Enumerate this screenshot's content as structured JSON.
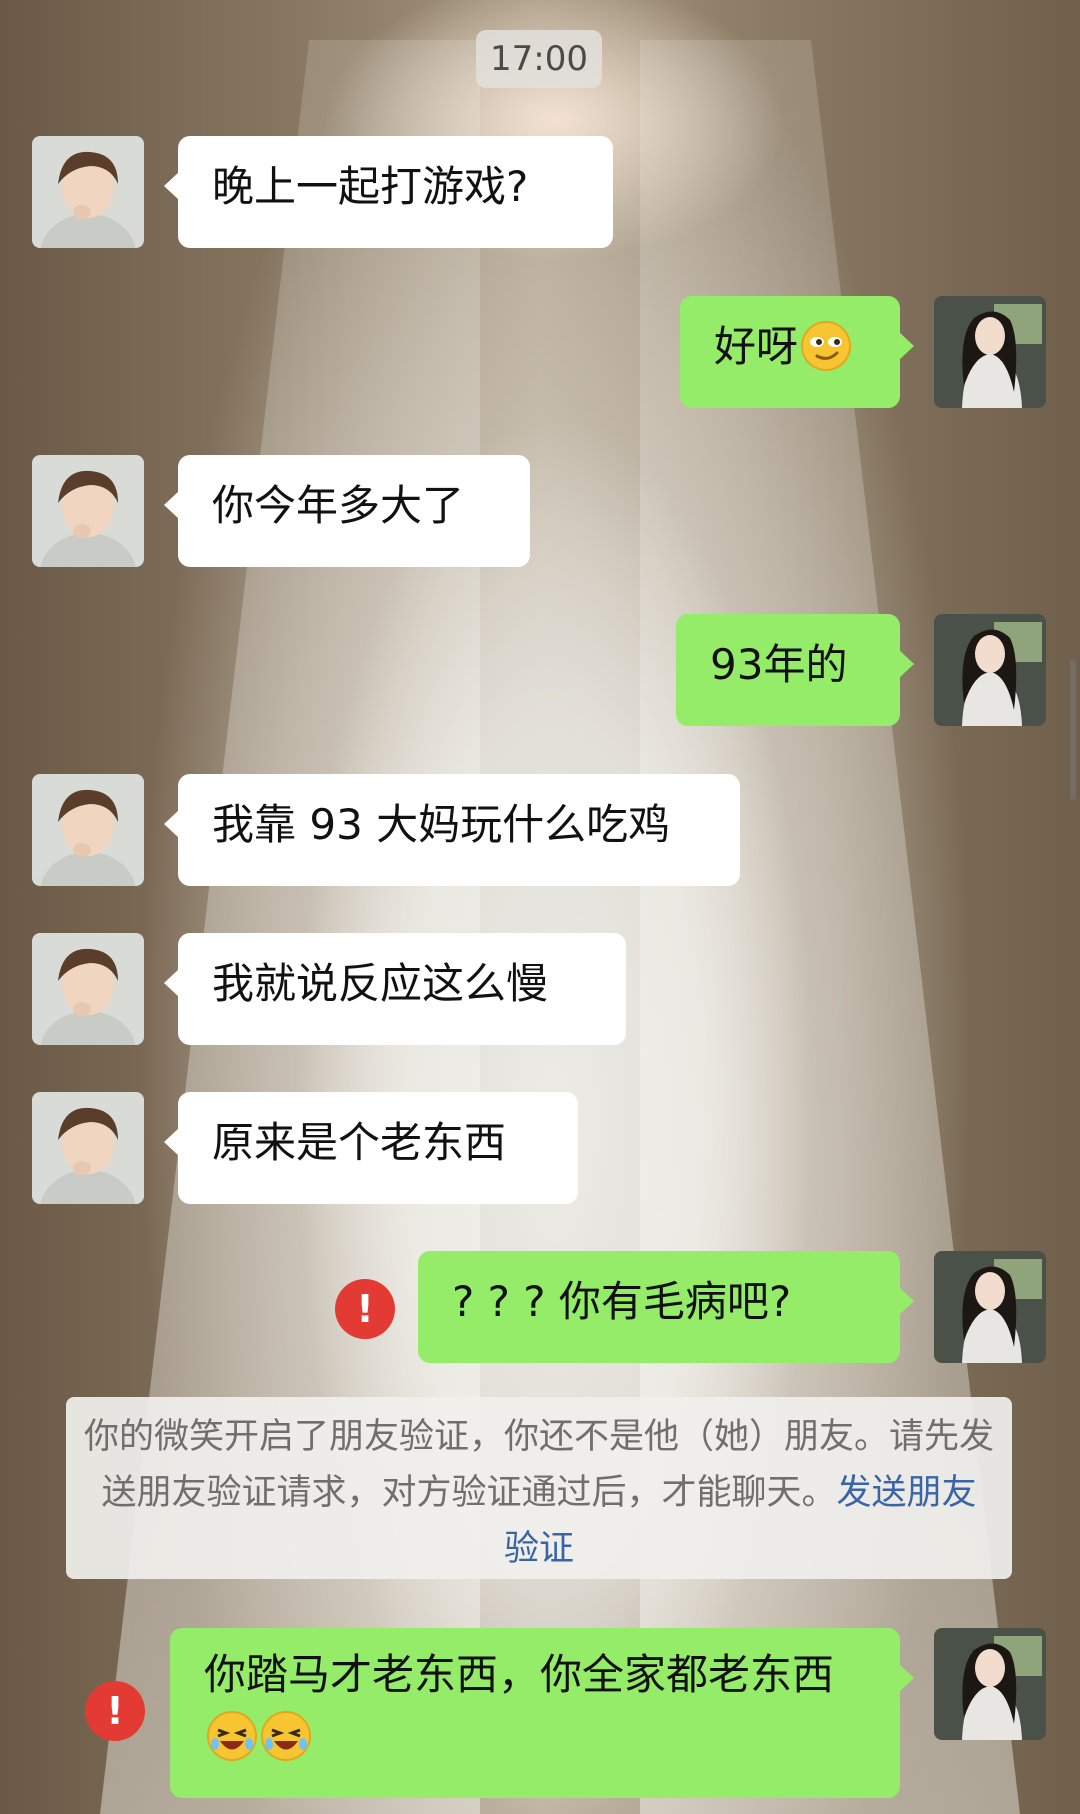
{
  "chat": {
    "time": "17:00",
    "messages": [
      {
        "side": "in",
        "text": "晚上一起打游戏?"
      },
      {
        "side": "out",
        "text": "好呀",
        "emoji": "smirk-emoji"
      },
      {
        "side": "in",
        "text": "你今年多大了"
      },
      {
        "side": "out",
        "text": "93年的"
      },
      {
        "side": "in",
        "text": "我靠 93 大妈玩什么吃鸡"
      },
      {
        "side": "in",
        "text": "我就说反应这么慢"
      },
      {
        "side": "in",
        "text": "原来是个老东西"
      },
      {
        "side": "out",
        "text": "? ? ? 你有毛病吧?",
        "status": "failed"
      },
      {
        "side": "out",
        "text": "你踏马才老东西，你全家都老东西",
        "emoji": "laughing-crying-emoji",
        "emoji_count": 2,
        "status": "failed"
      }
    ],
    "system_notice": {
      "text": "你的微笑开启了朋友验证，你还不是他（她）朋友。请先发送朋友验证请求，对方验证通过后，才能聊天。",
      "link": "发送朋友验证"
    },
    "error_glyph": "!",
    "colors": {
      "outgoing_bubble": "#95ec69",
      "incoming_bubble": "#ffffff",
      "error": "#e33a34",
      "link": "#3a64a6"
    }
  }
}
